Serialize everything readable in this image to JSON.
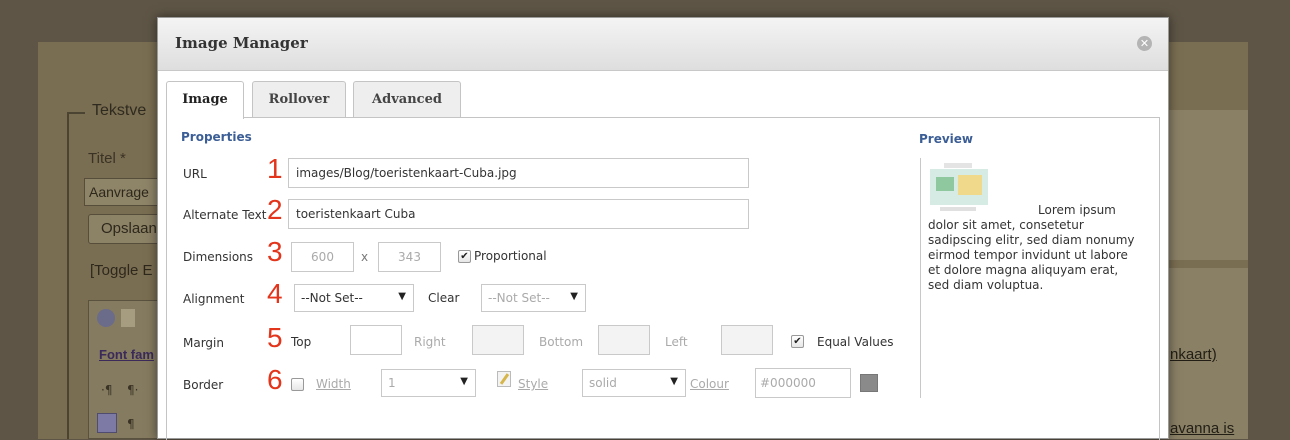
{
  "background": {
    "legend": "Tekstve",
    "title_label": "Titel *",
    "title_value": "Aanvrage",
    "save_button": "Opslaan",
    "toggle_link": "[Toggle E",
    "font_family": "Font fam",
    "right_link": "nkaart)",
    "right_text_2": "avanna is"
  },
  "modal": {
    "title": "Image Manager",
    "close_icon": "close-icon",
    "tabs": [
      "Image",
      "Rollover",
      "Advanced"
    ],
    "active_tab": "Image",
    "properties": {
      "heading": "Properties",
      "url": {
        "label": "URL",
        "marker": "1",
        "value": "images/Blog/toeristenkaart-Cuba.jpg"
      },
      "alt": {
        "label": "Alternate Text",
        "marker": "2",
        "value": "toeristenkaart Cuba"
      },
      "dimensions": {
        "label": "Dimensions",
        "marker": "3",
        "width": "600",
        "sep": "x",
        "height": "343",
        "proportional_label": "Proportional",
        "proportional_checked": true
      },
      "alignment": {
        "label": "Alignment",
        "marker": "4",
        "value": "--Not Set--",
        "clear_label": "Clear",
        "clear_value": "--Not Set--"
      },
      "margin": {
        "label": "Margin",
        "marker": "5",
        "top": "Top",
        "right": "Right",
        "bottom": "Bottom",
        "left": "Left",
        "equal_label": "Equal Values",
        "equal_checked": true
      },
      "border": {
        "label": "Border",
        "marker": "6",
        "checked": false,
        "width_label": "Width",
        "width_value": "1",
        "style_label": "Style",
        "style_value": "solid",
        "colour_label": "Colour",
        "colour_value": "#000000"
      }
    },
    "preview": {
      "heading": "Preview",
      "text": "Lorem ipsum dolor sit amet, consetetur sadipscing elitr, sed diam nonumy eirmod tempor invidunt ut labore et dolore magna aliquyam erat, sed diam voluptua."
    }
  },
  "colors": {
    "accent_heading": "#3c5e96",
    "marker_red": "#e3351b",
    "overlay": "#5e5546"
  }
}
